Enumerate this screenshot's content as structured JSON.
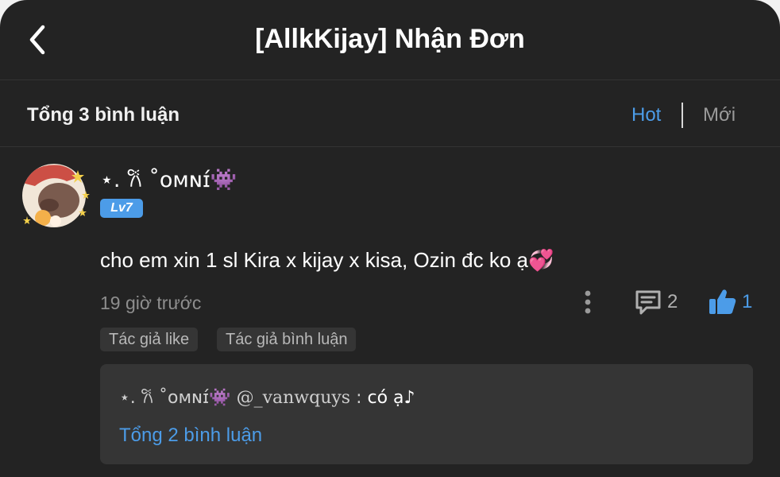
{
  "header": {
    "title": "[AllkKijay] Nhận Đơn"
  },
  "comments_bar": {
    "total_label": "Tổng 3 bình luận",
    "sort_hot": "Hot",
    "sort_new": "Mới"
  },
  "comment": {
    "author": "⋆. 𐙚 ˚ᴏᴍɴɪ́👾",
    "level": "Lv7",
    "text": "cho em xin 1 sl Kira x kijay x kisa, Ozin đc ko ạ💞",
    "time": "19 giờ trước",
    "reply_count": "2",
    "like_count": "1",
    "badges": [
      "Tác giả like",
      "Tác giả bình luận"
    ],
    "reply": {
      "author": "⋆. 𐙚 ˚ᴏᴍɴɪ́👾",
      "mention": "@_vanwquys",
      "colon": " : ",
      "message": "có ạ♪"
    },
    "reply_total_label": "Tổng 2 bình luận"
  },
  "colors": {
    "background": "#232323",
    "accent": "#4c9ce8",
    "muted": "#8e8e8e",
    "panel": "#353535"
  }
}
